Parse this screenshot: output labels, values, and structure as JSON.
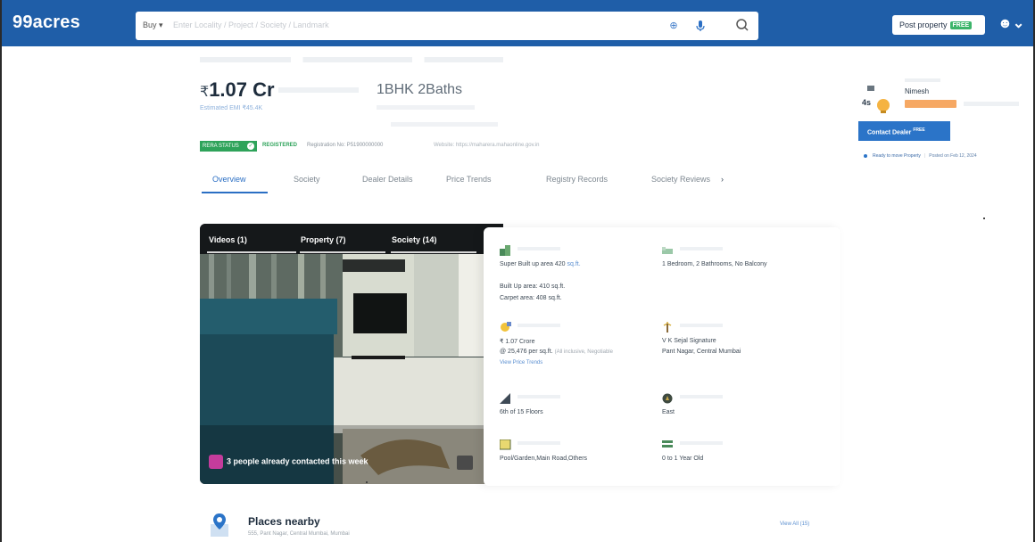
{
  "header": {
    "logo": "99acres",
    "search_type": "Buy",
    "search_placeholder": "Enter Locality / Project / Society / Landmark",
    "post_property": "Post property",
    "free_badge": "FREE",
    "colors": {
      "brand": "#1f5ea8",
      "accent": "#3cb46a"
    }
  },
  "listing": {
    "price": "1.07 Cr",
    "currency_symbol": "₹",
    "config": "1BHK 2Baths",
    "emi": "Estimated EMI ₹45.4K",
    "rera_status": "RERA STATUS",
    "rera_registered": "REGISTERED",
    "registration_no": "Registration No: P51900000000",
    "website": "Website: https://maharera.mahaonline.gov.in"
  },
  "tabs": [
    {
      "label": "Overview"
    },
    {
      "label": "Society"
    },
    {
      "label": "Dealer Details"
    },
    {
      "label": "Price Trends"
    },
    {
      "label": "Registry Records"
    },
    {
      "label": "Society Reviews"
    }
  ],
  "dealer": {
    "name": "Nimesh",
    "contact_button": "Contact Dealer",
    "contact_badge": "FREE",
    "ready_status": "Ready to move Property",
    "posted": "Posted on Feb 12, 2024"
  },
  "media": {
    "tabs": [
      {
        "label": "Videos (1)"
      },
      {
        "label": "Property (7)"
      },
      {
        "label": "Society (14)"
      }
    ],
    "contacted": "3 people already contacted this week"
  },
  "details": {
    "area": {
      "super_built_up": "Super Built up area 420",
      "super_unit": "sq.ft.",
      "built_up": "Built Up area: 410 sq.ft.",
      "carpet": "Carpet area: 408 sq.ft."
    },
    "config": "1 Bedroom, 2 Bathrooms, No Balcony",
    "price": {
      "value": "₹ 1.07 Crore",
      "per_sqft": "@ 25,476 per sq.ft.",
      "note": "(All inclusive, Negotiable",
      "trend_link": "View Price Trends"
    },
    "address": {
      "society": "V K Sejal Signature",
      "locality": "Pant Nagar, Central Mumbai"
    },
    "floor": "6th  of 15 Floors",
    "facing": "East",
    "overlooking": "Pool/Garden,Main Road,Others",
    "age": "0 to 1 Year Old"
  },
  "places": {
    "title": "Places nearby",
    "subtitle": "555, Pant Nagar, Central Mumbai, Mumbai",
    "view_all": "View All (15)"
  }
}
